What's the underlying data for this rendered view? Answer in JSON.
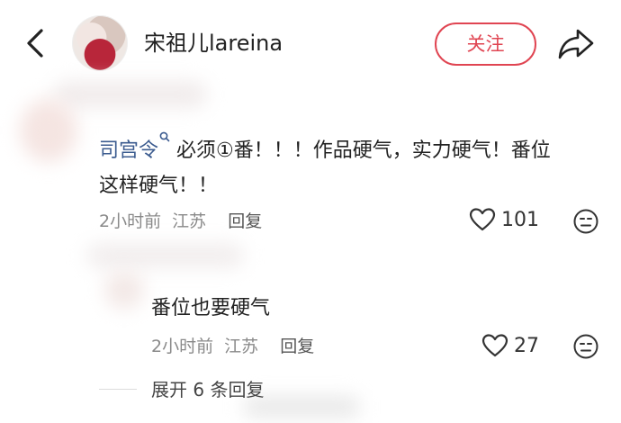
{
  "header": {
    "username": "宋祖儿lareina",
    "follow_label": "关注"
  },
  "comment": {
    "mention": "司宫令",
    "mention_icon": "search-icon",
    "text_line1": " 必须①番！！！作品硬气，实力硬气！番位",
    "text_line2": "这样硬气！！",
    "time": "2小时前",
    "location": "江苏",
    "reply_label": "回复",
    "likes": "101"
  },
  "reply": {
    "text": "番位也要硬气",
    "time": "2小时前",
    "location": "江苏",
    "reply_label": "回复",
    "likes": "27"
  },
  "expand_label": "展开 6 条回复",
  "colors": {
    "accent": "#e04552",
    "mention": "#3b5b8f"
  }
}
